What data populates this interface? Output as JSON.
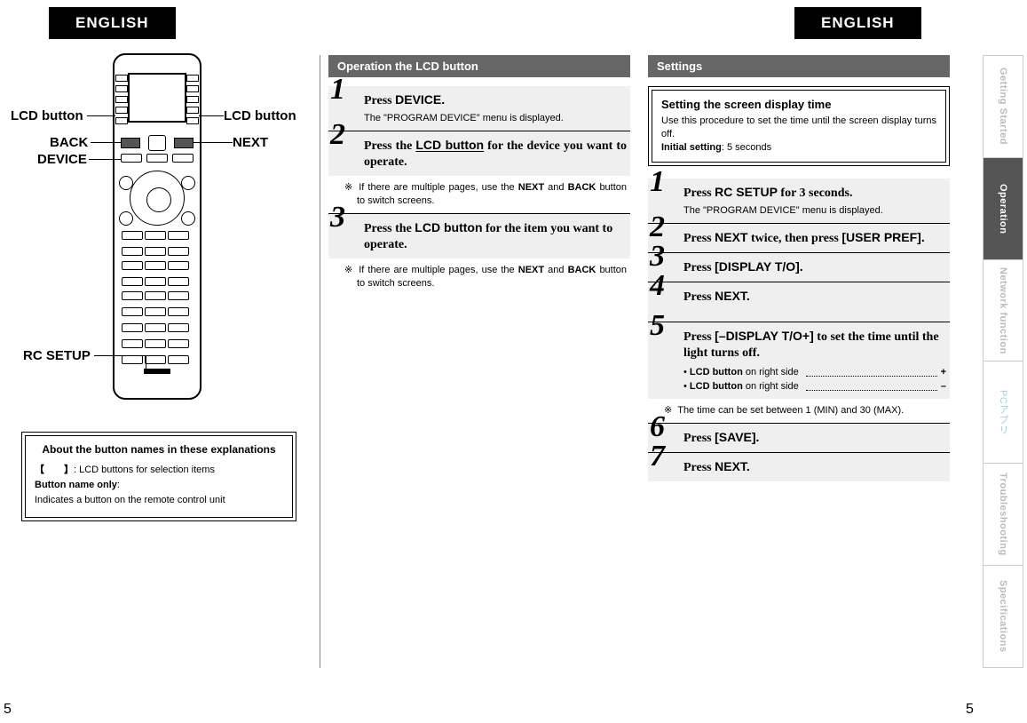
{
  "tabs": {
    "left": "ENGLISH",
    "right": "ENGLISH"
  },
  "remote_labels": {
    "lcd_left": "LCD button",
    "lcd_right": "LCD button",
    "back": "BACK",
    "device": "DEVICE",
    "next": "NEXT",
    "rc_setup": "RC SETUP"
  },
  "about": {
    "title": "About the button names in these explanations",
    "line1_a": "【　　】",
    "line1_b": ": LCD buttons for selection items",
    "line2_a": "Button name only",
    "line2_b": ":",
    "line3": "Indicates a button on the remote control unit"
  },
  "col2": {
    "header": "Operation the LCD button",
    "step1_head_a": "Press ",
    "step1_head_b": "DEVICE.",
    "step1_sub": "The \"PROGRAM DEVICE\" menu is displayed.",
    "step2_head_a": "Press the ",
    "step2_head_b": "LCD button",
    "step2_head_c": " for the device you want to operate.",
    "note_text_a": "If there are multiple pages, use the ",
    "note_next": "NEXT",
    "note_and": " and ",
    "note_back": "BACK",
    "note_text_b": " button to switch screens.",
    "step3_head_a": "Press the ",
    "step3_head_b": "LCD button",
    "step3_head_c": " for the item you want to operate."
  },
  "col3": {
    "header": "Settings",
    "setting_title": "Setting the screen display time",
    "setting_body": "Use this procedure to set the time until the screen display turns off.",
    "setting_initial_a": "Initial setting",
    "setting_initial_b": ": 5 seconds",
    "s1_a": "Press ",
    "s1_b": "RC SETUP",
    "s1_c": " for 3 seconds.",
    "s1_sub": "The \"PROGRAM DEVICE\" menu is displayed.",
    "s2_a": "Press ",
    "s2_b": "NEXT",
    "s2_c": " twice, then press ",
    "s2_d": "[USER PREF].",
    "s3_a": "Press ",
    "s3_b": "[DISPLAY T/O].",
    "s4_a": "Press ",
    "s4_b": "NEXT.",
    "s5_a": "Press ",
    "s5_b": "[–DISPLAY T/O+]",
    "s5_c": " to set the time until the light turns off.",
    "s5_bul_a": "LCD button",
    "s5_bul_at": " on right side",
    "s5_bul_ap": "+",
    "s5_bul_am": "–",
    "s5_note": "The time can be set between 1 (MIN) and 30 (MAX).",
    "s6_a": "Press ",
    "s6_b": "[SAVE].",
    "s7_a": "Press ",
    "s7_b": "NEXT."
  },
  "note_symbol": "※",
  "sidenav": {
    "getting_started": "Getting Started",
    "operation": "Operation",
    "network": "Network function",
    "pcapp": "PCアプリ",
    "troubleshooting": "Troubleshooting",
    "specifications": "Specifications"
  },
  "pagenum": "5"
}
